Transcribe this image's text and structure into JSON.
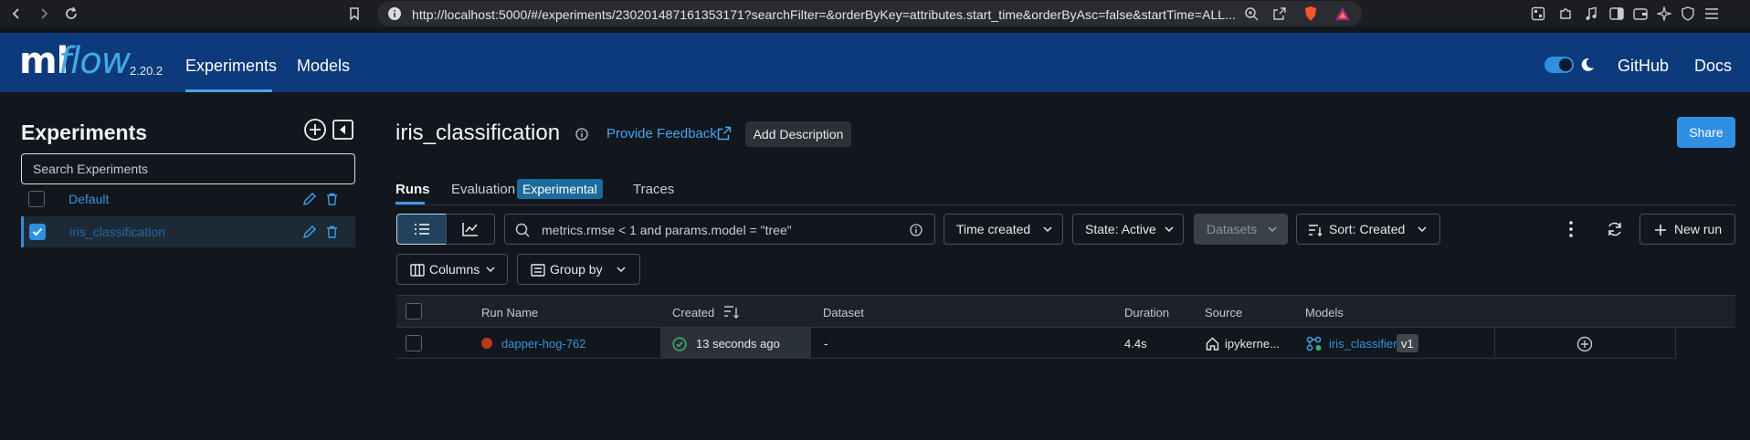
{
  "browser": {
    "url": "http://localhost:5000/#/experiments/230201487161353171?searchFilter=&orderByKey=attributes.start_time&orderByAsc=false&startTime=ALL..."
  },
  "header": {
    "logo_ml": "ml",
    "logo_flow": "flow",
    "version": "2.20.2",
    "nav": [
      {
        "label": "Experiments",
        "active": true
      },
      {
        "label": "Models",
        "active": false
      }
    ],
    "github_label": "GitHub",
    "docs_label": "Docs",
    "dark_mode": true
  },
  "sidebar": {
    "title": "Experiments",
    "search_placeholder": "Search Experiments",
    "experiments": [
      {
        "name": "Default",
        "checked": false
      },
      {
        "name": "iris_classification",
        "checked": true
      }
    ]
  },
  "main": {
    "title": "iris_classification",
    "feedback_label": "Provide Feedback",
    "add_description_label": "Add Description",
    "share_label": "Share",
    "tabs": [
      {
        "label": "Runs",
        "active": true
      },
      {
        "label": "Evaluation",
        "badge": "Experimental"
      },
      {
        "label": "Traces"
      }
    ],
    "filter_text": "metrics.rmse < 1 and params.model = \"tree\"",
    "time_filter": "Time created",
    "state_filter": "State: Active",
    "datasets_label": "Datasets",
    "sort_label": "Sort: Created",
    "new_run_label": "New run",
    "columns_label": "Columns",
    "group_by_label": "Group by"
  },
  "table": {
    "headers": [
      "Run Name",
      "Created",
      "Dataset",
      "Duration",
      "Source",
      "Models"
    ],
    "rows": [
      {
        "run_name": "dapper-hog-762",
        "created": "13 seconds ago",
        "dataset": "-",
        "duration": "4.4s",
        "source": "ipykerne...",
        "model": "iris_classifier",
        "model_version": "v1"
      }
    ]
  },
  "colors": {
    "header_bg": "#0c3a7a",
    "accent": "#2f8fe0",
    "link": "#3a93e0",
    "status_failed": "#b83a1a",
    "status_success": "#3db36a"
  }
}
